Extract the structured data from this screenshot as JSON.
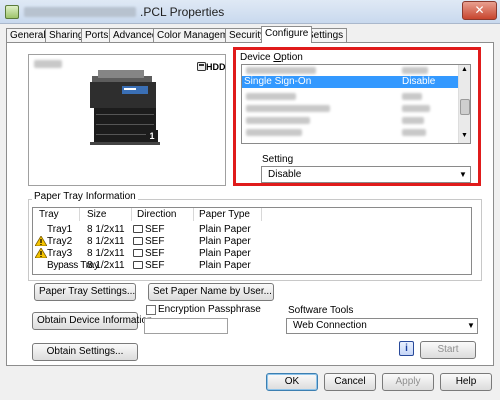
{
  "window": {
    "title_suffix": ".PCL Properties",
    "close_glyph": "✕"
  },
  "tabs": [
    {
      "label": "General"
    },
    {
      "label": "Sharing"
    },
    {
      "label": "Ports"
    },
    {
      "label": "Advanced"
    },
    {
      "label": "Color Management"
    },
    {
      "label": "Security"
    },
    {
      "label": "Configure",
      "active": true
    },
    {
      "label": "Settings"
    }
  ],
  "preview": {
    "hdd_label": "HDD",
    "device_icon": "printer-icon",
    "tray_number": "1"
  },
  "device_option": {
    "label": "Device Option",
    "label_underline_char": "O",
    "selected_row": {
      "name": "Single Sign-On",
      "value": "Disable"
    }
  },
  "setting": {
    "label": "Setting",
    "value": "Disable"
  },
  "paper_tray": {
    "group_title": "Paper Tray Information",
    "columns": [
      "Tray",
      "Size",
      "Direction",
      "Paper Type"
    ],
    "rows": [
      {
        "tray": "Tray1",
        "size": "8 1/2x11",
        "direction": "SEF",
        "type": "Plain Paper",
        "warning": false
      },
      {
        "tray": "Tray2",
        "size": "8 1/2x11",
        "direction": "SEF",
        "type": "Plain Paper",
        "warning": true
      },
      {
        "tray": "Tray3",
        "size": "8 1/2x11",
        "direction": "SEF",
        "type": "Plain Paper",
        "warning": true
      },
      {
        "tray": "Bypass Tray",
        "size": "8 1/2x11",
        "direction": "SEF",
        "type": "Plain Paper",
        "warning": false
      }
    ]
  },
  "buttons": {
    "paper_tray_settings": "Paper Tray Settings...",
    "set_paper_name": "Set Paper Name by User...",
    "obtain_device_info": "Obtain Device Information",
    "obtain_settings": "Obtain Settings...",
    "start": "Start",
    "ok": "OK",
    "cancel": "Cancel",
    "apply": "Apply",
    "help": "Help"
  },
  "encryption": {
    "label": "Encryption Passphrase",
    "checked": false,
    "value": ""
  },
  "software_tools": {
    "label": "Software Tools",
    "value": "Web Connection",
    "info_glyph": "i"
  },
  "colors": {
    "highlight": "#e01b1b",
    "selection": "#3399ff",
    "warning": "#f5c400"
  }
}
